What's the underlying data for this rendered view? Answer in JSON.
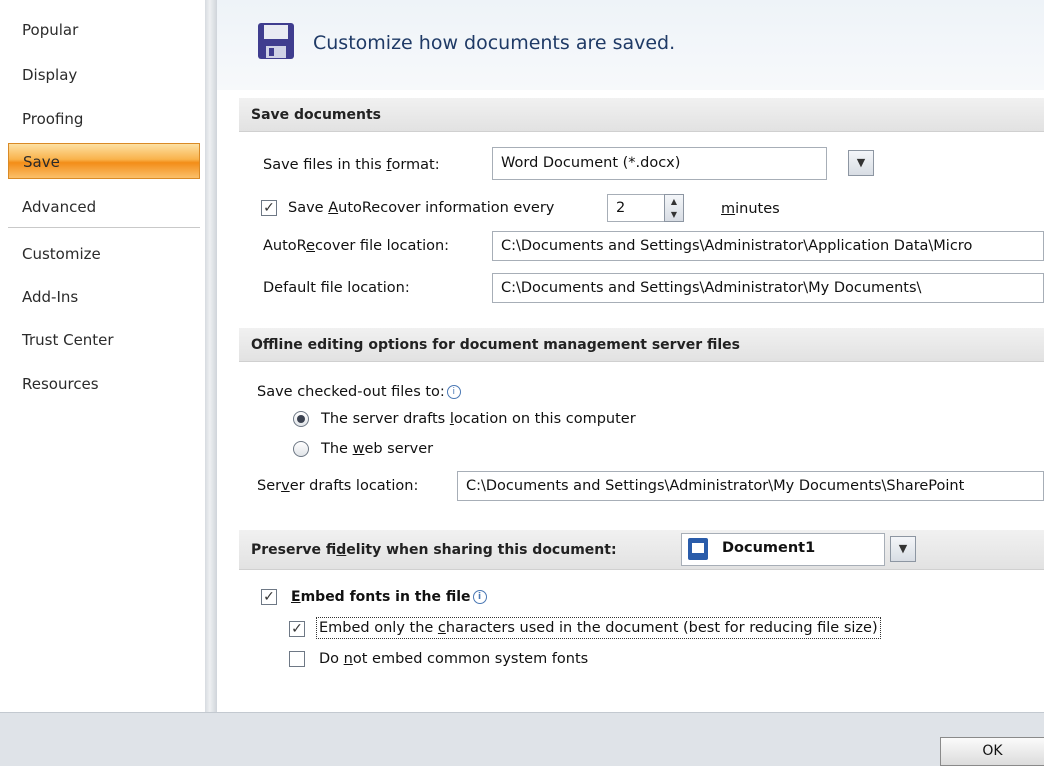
{
  "sidebar": {
    "items": [
      {
        "label": "Popular"
      },
      {
        "label": "Display"
      },
      {
        "label": "Proofing"
      },
      {
        "label": "Save",
        "selected": true
      },
      {
        "label": "Advanced"
      },
      {
        "label": "Customize"
      },
      {
        "label": "Add-Ins"
      },
      {
        "label": "Trust Center"
      },
      {
        "label": "Resources"
      }
    ]
  },
  "header": {
    "icon": "save-floppy-icon",
    "title": "Customize how documents are saved."
  },
  "save_documents": {
    "section_title": "Save documents",
    "format_label_pre": "Save files in this ",
    "format_label_key": "f",
    "format_label_post": "ormat:",
    "format_value": "Word Document (*.docx)",
    "autorecover_checked": true,
    "autorecover_label_pre": "Save ",
    "autorecover_label_key": "A",
    "autorecover_label_post": "utoRecover information every",
    "autorecover_minutes": "2",
    "minutes_label_key": "m",
    "minutes_label_post": "inutes",
    "autorecover_location_label_pre": "AutoR",
    "autorecover_location_label_key": "e",
    "autorecover_location_label_post": "cover file location:",
    "autorecover_location_value": "C:\\Documents and Settings\\Administrator\\Application Data\\Micro",
    "default_location_label_pre": "Default f",
    "default_location_label_key": "i",
    "default_location_label_post": "le location:",
    "default_location_value": "C:\\Documents and Settings\\Administrator\\My Documents\\"
  },
  "offline_editing": {
    "section_title": "Offline editing options for document management server files",
    "save_checked_out_label": "Save checked-out files to:",
    "radio_server_drafts_pre": "The server drafts ",
    "radio_server_drafts_key": "l",
    "radio_server_drafts_post": "ocation on this computer",
    "radio_server_drafts_selected": true,
    "radio_web_server_pre": "The ",
    "radio_web_server_key": "w",
    "radio_web_server_post": "eb server",
    "radio_web_server_selected": false,
    "server_drafts_label_pre": "Ser",
    "server_drafts_label_key": "v",
    "server_drafts_label_post": "er drafts location:",
    "server_drafts_value": "C:\\Documents and Settings\\Administrator\\My Documents\\SharePoint"
  },
  "fidelity": {
    "section_title_pre": "Preserve fi",
    "section_title_key": "d",
    "section_title_post": "elity when sharing this document:",
    "document_value": "Document1",
    "embed_fonts_checked": true,
    "embed_fonts_key": "E",
    "embed_fonts_post": "mbed fonts in the file",
    "embed_only_checked": true,
    "embed_only_pre": "Embed only the ",
    "embed_only_key": "c",
    "embed_only_post": "haracters used in the document (best for reducing file size)",
    "no_common_checked": false,
    "no_common_pre": "Do ",
    "no_common_key": "n",
    "no_common_post": "ot embed common system fonts"
  },
  "footer": {
    "ok_label": "OK"
  },
  "colors": {
    "selected_nav": "#f9b34c",
    "title_text": "#1f3a66",
    "footer_bg": "#dfe3e8"
  }
}
